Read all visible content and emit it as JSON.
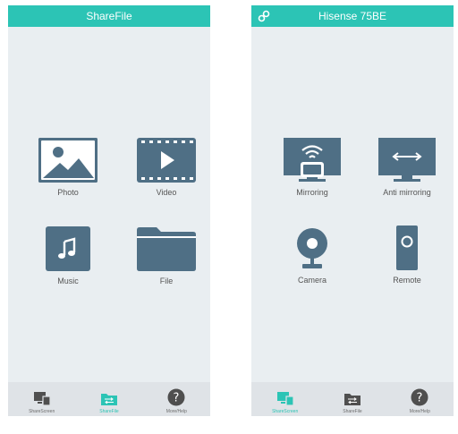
{
  "left_screen": {
    "title": "ShareFile",
    "tiles": [
      {
        "label": "Photo",
        "icon": "photo-icon"
      },
      {
        "label": "Video",
        "icon": "video-icon"
      },
      {
        "label": "Music",
        "icon": "music-icon"
      },
      {
        "label": "File",
        "icon": "folder-icon"
      }
    ],
    "tabs": [
      {
        "label": "ShareScreen",
        "icon": "sharescreen-icon",
        "active": false
      },
      {
        "label": "ShareFile",
        "icon": "sharefile-icon",
        "active": true
      },
      {
        "label": "More/Help",
        "icon": "help-icon",
        "active": false
      }
    ]
  },
  "right_screen": {
    "title": "Hisense 75BE",
    "tiles": [
      {
        "label": "Mirroring",
        "icon": "mirroring-icon"
      },
      {
        "label": "Anti mirroring",
        "icon": "anti-mirroring-icon"
      },
      {
        "label": "Camera",
        "icon": "camera-icon"
      },
      {
        "label": "Remote",
        "icon": "remote-icon"
      }
    ],
    "tabs": [
      {
        "label": "ShareScreen",
        "icon": "sharescreen-icon",
        "active": true
      },
      {
        "label": "ShareFile",
        "icon": "sharefile-icon",
        "active": false
      },
      {
        "label": "More/Help",
        "icon": "help-icon",
        "active": false
      }
    ]
  },
  "colors": {
    "accent": "#2cc4b5",
    "icon": "#4f6f85",
    "background": "#e9eef1",
    "tabbar": "#dfe3e7"
  }
}
